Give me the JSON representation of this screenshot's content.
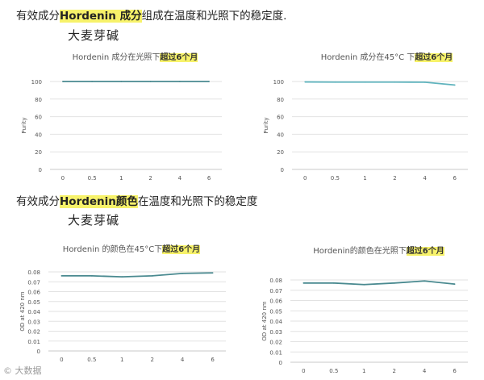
{
  "heading1": {
    "pre": "有效成分",
    "hl": "Hordenin 成分",
    "post": "组成在温度和光照下的稳定度."
  },
  "sub1": "大麦芽碱",
  "heading2": {
    "pre": "有效成分",
    "hl": "Hordenin颜色",
    "post": "在温度和光照下的稳定度"
  },
  "sub2": "大麦芽碱",
  "watermark": "© 大数据",
  "colors": {
    "line": "#4a8a90",
    "line2": "#5fb3bd",
    "highlight": "#f7f26a",
    "grid": "#e2e2e2"
  },
  "chart_data": [
    {
      "type": "line",
      "title_pre": "Hordenin 成分在光照下",
      "title_hl": "超过6个月",
      "ylabel": "Purity",
      "xlabel": "",
      "categories": [
        "0",
        "0.5",
        "1",
        "2",
        "4",
        "6"
      ],
      "series": [
        {
          "values": [
            100,
            100,
            100,
            100,
            100,
            100
          ]
        }
      ],
      "ylim": [
        0,
        100
      ],
      "yticks": [
        "0",
        "20",
        "40",
        "60",
        "80",
        "100"
      ],
      "grid": true
    },
    {
      "type": "line",
      "title_pre": "Hordenin 成分在45°C 下",
      "title_hl": "超过6个月",
      "ylabel": "Purity",
      "xlabel": "",
      "categories": [
        "0",
        "0.5",
        "1",
        "2",
        "4",
        "6"
      ],
      "series": [
        {
          "values": [
            99.5,
            99.3,
            99.3,
            99.3,
            99.2,
            96
          ]
        }
      ],
      "ylim": [
        0,
        100
      ],
      "yticks": [
        "0",
        "20",
        "40",
        "60",
        "80",
        "100"
      ],
      "grid": true
    },
    {
      "type": "line",
      "title_pre": "Hordenin 的颜色在45°C下",
      "title_hl": "超过6个月",
      "ylabel": "OD at 420 nm",
      "xlabel": "",
      "categories": [
        "0",
        "0.5",
        "1",
        "2",
        "4",
        "6"
      ],
      "series": [
        {
          "values": [
            0.076,
            0.076,
            0.075,
            0.076,
            0.0785,
            0.079
          ]
        }
      ],
      "ylim": [
        0,
        0.08
      ],
      "yticks": [
        "0",
        "0.01",
        "0.02",
        "0.03",
        "0.04",
        "0.05",
        "0.06",
        "0.07",
        "0.08"
      ],
      "grid": true
    },
    {
      "type": "line",
      "title_pre": "Hordenin的颜色在光照下",
      "title_hl": "超过6个月",
      "ylabel": "OD at 420 nm",
      "xlabel": "",
      "categories": [
        "0",
        "0.5",
        "1",
        "2",
        "4",
        "6"
      ],
      "series": [
        {
          "values": [
            0.077,
            0.077,
            0.0755,
            0.077,
            0.079,
            0.076
          ]
        }
      ],
      "ylim": [
        0,
        0.08
      ],
      "yticks": [
        "0",
        "0.01",
        "0.02",
        "0.03",
        "0.04",
        "0.05",
        "0.06",
        "0.07",
        "0.08"
      ],
      "grid": true
    }
  ]
}
